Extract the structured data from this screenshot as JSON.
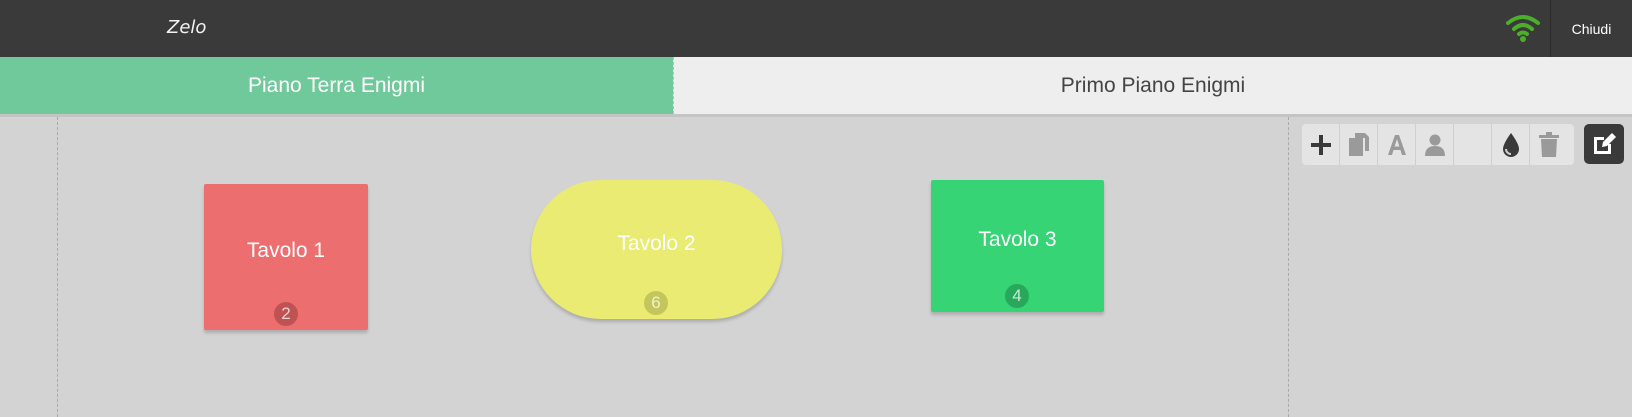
{
  "app": {
    "title": "Zelo",
    "close_label": "Chiudi"
  },
  "tabs": [
    {
      "label": "Piano Terra Enigmi",
      "active": true
    },
    {
      "label": "Primo Piano Enigmi",
      "active": false
    }
  ],
  "tables": [
    {
      "name": "Tavolo 1",
      "seats": "2",
      "shape": "rectangle",
      "color": "#ec6e6e"
    },
    {
      "name": "Tavolo 2",
      "seats": "6",
      "shape": "oval",
      "color": "#eaeb72"
    },
    {
      "name": "Tavolo 3",
      "seats": "4",
      "shape": "rectangle",
      "color": "#37d476"
    }
  ],
  "toolbar": {
    "tools": [
      "plus-icon",
      "copy-icon",
      "text-icon",
      "user-icon",
      "blank",
      "color-drop-icon",
      "trash-icon"
    ],
    "edit": "edit-icon"
  },
  "colors": {
    "topbar": "#3a3a3a",
    "active_tab": "#6fc99b",
    "wifi": "#4caf2a",
    "floor": "#d3d3d3"
  }
}
